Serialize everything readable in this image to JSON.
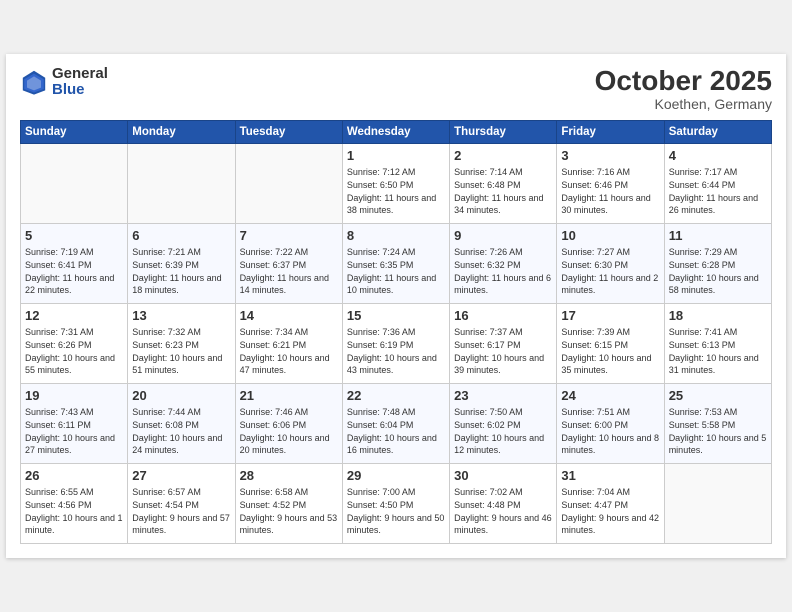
{
  "header": {
    "logo_general": "General",
    "logo_blue": "Blue",
    "month": "October 2025",
    "location": "Koethen, Germany"
  },
  "weekdays": [
    "Sunday",
    "Monday",
    "Tuesday",
    "Wednesday",
    "Thursday",
    "Friday",
    "Saturday"
  ],
  "weeks": [
    [
      {
        "num": "",
        "sunrise": "",
        "sunset": "",
        "daylight": ""
      },
      {
        "num": "",
        "sunrise": "",
        "sunset": "",
        "daylight": ""
      },
      {
        "num": "",
        "sunrise": "",
        "sunset": "",
        "daylight": ""
      },
      {
        "num": "1",
        "sunrise": "Sunrise: 7:12 AM",
        "sunset": "Sunset: 6:50 PM",
        "daylight": "Daylight: 11 hours and 38 minutes."
      },
      {
        "num": "2",
        "sunrise": "Sunrise: 7:14 AM",
        "sunset": "Sunset: 6:48 PM",
        "daylight": "Daylight: 11 hours and 34 minutes."
      },
      {
        "num": "3",
        "sunrise": "Sunrise: 7:16 AM",
        "sunset": "Sunset: 6:46 PM",
        "daylight": "Daylight: 11 hours and 30 minutes."
      },
      {
        "num": "4",
        "sunrise": "Sunrise: 7:17 AM",
        "sunset": "Sunset: 6:44 PM",
        "daylight": "Daylight: 11 hours and 26 minutes."
      }
    ],
    [
      {
        "num": "5",
        "sunrise": "Sunrise: 7:19 AM",
        "sunset": "Sunset: 6:41 PM",
        "daylight": "Daylight: 11 hours and 22 minutes."
      },
      {
        "num": "6",
        "sunrise": "Sunrise: 7:21 AM",
        "sunset": "Sunset: 6:39 PM",
        "daylight": "Daylight: 11 hours and 18 minutes."
      },
      {
        "num": "7",
        "sunrise": "Sunrise: 7:22 AM",
        "sunset": "Sunset: 6:37 PM",
        "daylight": "Daylight: 11 hours and 14 minutes."
      },
      {
        "num": "8",
        "sunrise": "Sunrise: 7:24 AM",
        "sunset": "Sunset: 6:35 PM",
        "daylight": "Daylight: 11 hours and 10 minutes."
      },
      {
        "num": "9",
        "sunrise": "Sunrise: 7:26 AM",
        "sunset": "Sunset: 6:32 PM",
        "daylight": "Daylight: 11 hours and 6 minutes."
      },
      {
        "num": "10",
        "sunrise": "Sunrise: 7:27 AM",
        "sunset": "Sunset: 6:30 PM",
        "daylight": "Daylight: 11 hours and 2 minutes."
      },
      {
        "num": "11",
        "sunrise": "Sunrise: 7:29 AM",
        "sunset": "Sunset: 6:28 PM",
        "daylight": "Daylight: 10 hours and 58 minutes."
      }
    ],
    [
      {
        "num": "12",
        "sunrise": "Sunrise: 7:31 AM",
        "sunset": "Sunset: 6:26 PM",
        "daylight": "Daylight: 10 hours and 55 minutes."
      },
      {
        "num": "13",
        "sunrise": "Sunrise: 7:32 AM",
        "sunset": "Sunset: 6:23 PM",
        "daylight": "Daylight: 10 hours and 51 minutes."
      },
      {
        "num": "14",
        "sunrise": "Sunrise: 7:34 AM",
        "sunset": "Sunset: 6:21 PM",
        "daylight": "Daylight: 10 hours and 47 minutes."
      },
      {
        "num": "15",
        "sunrise": "Sunrise: 7:36 AM",
        "sunset": "Sunset: 6:19 PM",
        "daylight": "Daylight: 10 hours and 43 minutes."
      },
      {
        "num": "16",
        "sunrise": "Sunrise: 7:37 AM",
        "sunset": "Sunset: 6:17 PM",
        "daylight": "Daylight: 10 hours and 39 minutes."
      },
      {
        "num": "17",
        "sunrise": "Sunrise: 7:39 AM",
        "sunset": "Sunset: 6:15 PM",
        "daylight": "Daylight: 10 hours and 35 minutes."
      },
      {
        "num": "18",
        "sunrise": "Sunrise: 7:41 AM",
        "sunset": "Sunset: 6:13 PM",
        "daylight": "Daylight: 10 hours and 31 minutes."
      }
    ],
    [
      {
        "num": "19",
        "sunrise": "Sunrise: 7:43 AM",
        "sunset": "Sunset: 6:11 PM",
        "daylight": "Daylight: 10 hours and 27 minutes."
      },
      {
        "num": "20",
        "sunrise": "Sunrise: 7:44 AM",
        "sunset": "Sunset: 6:08 PM",
        "daylight": "Daylight: 10 hours and 24 minutes."
      },
      {
        "num": "21",
        "sunrise": "Sunrise: 7:46 AM",
        "sunset": "Sunset: 6:06 PM",
        "daylight": "Daylight: 10 hours and 20 minutes."
      },
      {
        "num": "22",
        "sunrise": "Sunrise: 7:48 AM",
        "sunset": "Sunset: 6:04 PM",
        "daylight": "Daylight: 10 hours and 16 minutes."
      },
      {
        "num": "23",
        "sunrise": "Sunrise: 7:50 AM",
        "sunset": "Sunset: 6:02 PM",
        "daylight": "Daylight: 10 hours and 12 minutes."
      },
      {
        "num": "24",
        "sunrise": "Sunrise: 7:51 AM",
        "sunset": "Sunset: 6:00 PM",
        "daylight": "Daylight: 10 hours and 8 minutes."
      },
      {
        "num": "25",
        "sunrise": "Sunrise: 7:53 AM",
        "sunset": "Sunset: 5:58 PM",
        "daylight": "Daylight: 10 hours and 5 minutes."
      }
    ],
    [
      {
        "num": "26",
        "sunrise": "Sunrise: 6:55 AM",
        "sunset": "Sunset: 4:56 PM",
        "daylight": "Daylight: 10 hours and 1 minute."
      },
      {
        "num": "27",
        "sunrise": "Sunrise: 6:57 AM",
        "sunset": "Sunset: 4:54 PM",
        "daylight": "Daylight: 9 hours and 57 minutes."
      },
      {
        "num": "28",
        "sunrise": "Sunrise: 6:58 AM",
        "sunset": "Sunset: 4:52 PM",
        "daylight": "Daylight: 9 hours and 53 minutes."
      },
      {
        "num": "29",
        "sunrise": "Sunrise: 7:00 AM",
        "sunset": "Sunset: 4:50 PM",
        "daylight": "Daylight: 9 hours and 50 minutes."
      },
      {
        "num": "30",
        "sunrise": "Sunrise: 7:02 AM",
        "sunset": "Sunset: 4:48 PM",
        "daylight": "Daylight: 9 hours and 46 minutes."
      },
      {
        "num": "31",
        "sunrise": "Sunrise: 7:04 AM",
        "sunset": "Sunset: 4:47 PM",
        "daylight": "Daylight: 9 hours and 42 minutes."
      },
      {
        "num": "",
        "sunrise": "",
        "sunset": "",
        "daylight": ""
      }
    ]
  ]
}
